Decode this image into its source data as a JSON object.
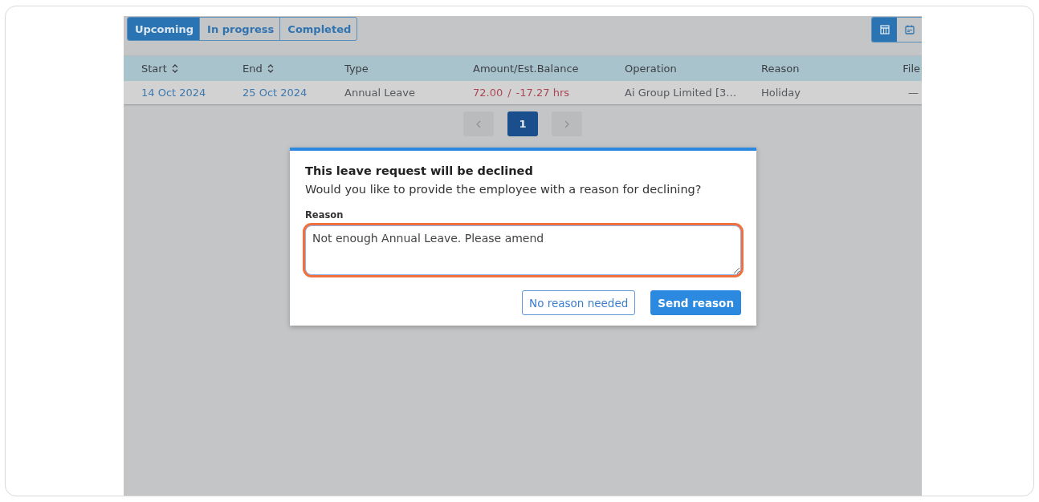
{
  "tabs": [
    {
      "label": "Upcoming",
      "selected": true
    },
    {
      "label": "In progress",
      "selected": false
    },
    {
      "label": "Completed",
      "selected": false
    }
  ],
  "view_toggle": [
    {
      "kind": "table",
      "selected": true
    },
    {
      "kind": "calendar",
      "selected": false
    }
  ],
  "table": {
    "columns": [
      {
        "label": "Start",
        "sortable": true
      },
      {
        "label": "End",
        "sortable": true
      },
      {
        "label": "Type",
        "sortable": false
      },
      {
        "label": "Amount/Est.Balance",
        "sortable": false
      },
      {
        "label": "Operation",
        "sortable": false
      },
      {
        "label": "Reason",
        "sortable": false
      },
      {
        "label": "File",
        "sortable": false
      }
    ],
    "rows": [
      {
        "start": "14 Oct 2024",
        "end": "25 Oct 2024",
        "type": "Annual Leave",
        "amount": "72.00",
        "separator": "/",
        "balance": "-17.27 hrs",
        "operation": "Ai Group Limited [3…",
        "reason": "Holiday",
        "file": "—"
      }
    ]
  },
  "pagination": {
    "prev_disabled": true,
    "next_disabled": true,
    "pages": [
      {
        "label": "1",
        "selected": true
      }
    ]
  },
  "dialog": {
    "title": "This leave request will be declined",
    "message": "Would you like to provide the employee with a reason for declining?",
    "field_label": "Reason",
    "value": "Not enough Annual Leave. Please amend",
    "highlighted": true,
    "buttons": [
      {
        "label": "No reason needed",
        "kind": "secondary"
      },
      {
        "label": "Send reason",
        "kind": "primary"
      }
    ]
  }
}
